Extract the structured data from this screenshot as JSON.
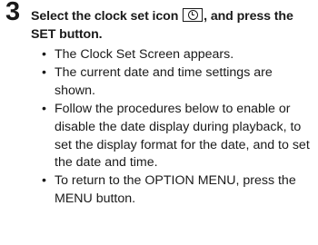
{
  "step": {
    "number": "3",
    "heading_part1": "Select the clock set icon ",
    "heading_icon": "clock-icon",
    "heading_part2": ", and press the SET button."
  },
  "bullet_symbol": "•",
  "bullets": [
    "The Clock Set Screen appears.",
    "The current date and time settings are shown.",
    "Follow the procedures below to enable or disable the date display during playback, to set the display format for the date, and to set the date and time.",
    "To return to the OPTION MENU, press the MENU button."
  ]
}
